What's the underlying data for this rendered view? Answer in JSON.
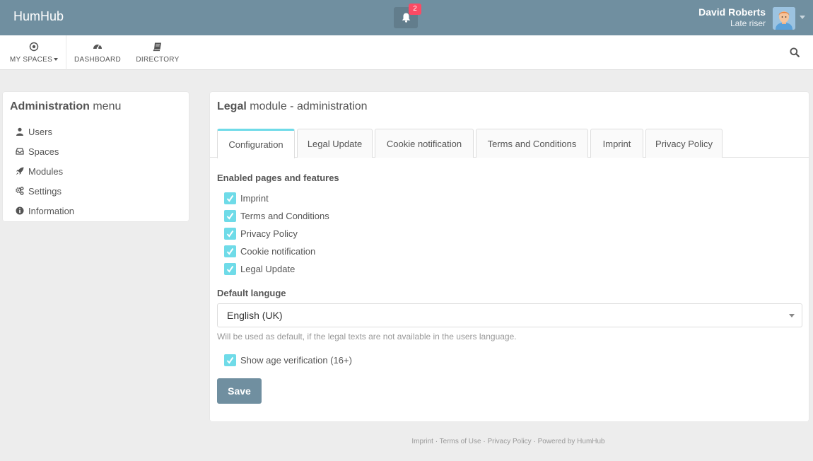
{
  "app": {
    "brand": "HumHub"
  },
  "notifications": {
    "count": "2",
    "icon": "bell-icon"
  },
  "user": {
    "name": "David Roberts",
    "title": "Late riser"
  },
  "nav": {
    "my_spaces": "MY SPACES",
    "dashboard": "DASHBOARD",
    "directory": "DIRECTORY"
  },
  "admin_menu": {
    "title_bold": "Administration",
    "title_light": "menu",
    "items": [
      {
        "label": "Users",
        "icon": "user-icon"
      },
      {
        "label": "Spaces",
        "icon": "inbox-icon"
      },
      {
        "label": "Modules",
        "icon": "rocket-icon"
      },
      {
        "label": "Settings",
        "icon": "gears-icon"
      },
      {
        "label": "Information",
        "icon": "info-circle-icon"
      }
    ]
  },
  "main": {
    "title_bold": "Legal",
    "title_light": "module - administration",
    "tabs": [
      {
        "label": "Configuration",
        "active": true
      },
      {
        "label": "Legal Update",
        "active": false
      },
      {
        "label": "Cookie notification",
        "active": false
      },
      {
        "label": "Terms and Conditions",
        "active": false
      },
      {
        "label": "Imprint",
        "active": false
      },
      {
        "label": "Privacy Policy",
        "active": false
      }
    ],
    "enabled_label": "Enabled pages and features",
    "features": [
      {
        "label": "Imprint",
        "checked": true
      },
      {
        "label": "Terms and Conditions",
        "checked": true
      },
      {
        "label": "Privacy Policy",
        "checked": true
      },
      {
        "label": "Cookie notification",
        "checked": true
      },
      {
        "label": "Legal Update",
        "checked": true
      }
    ],
    "default_language_label": "Default languge",
    "default_language_value": "English (UK)",
    "default_language_hint": "Will be used as default, if the legal texts are not available in the users language.",
    "age_verification_label": "Show age verification (16+)",
    "age_verification_checked": true,
    "save_label": "Save"
  },
  "footer": {
    "links": [
      "Imprint",
      "Terms of Use",
      "Privacy Policy"
    ],
    "powered": "Powered by HumHub"
  },
  "colors": {
    "topbar": "#708fa0",
    "accent": "#6fdbe8",
    "badge": "#fc4a64"
  }
}
